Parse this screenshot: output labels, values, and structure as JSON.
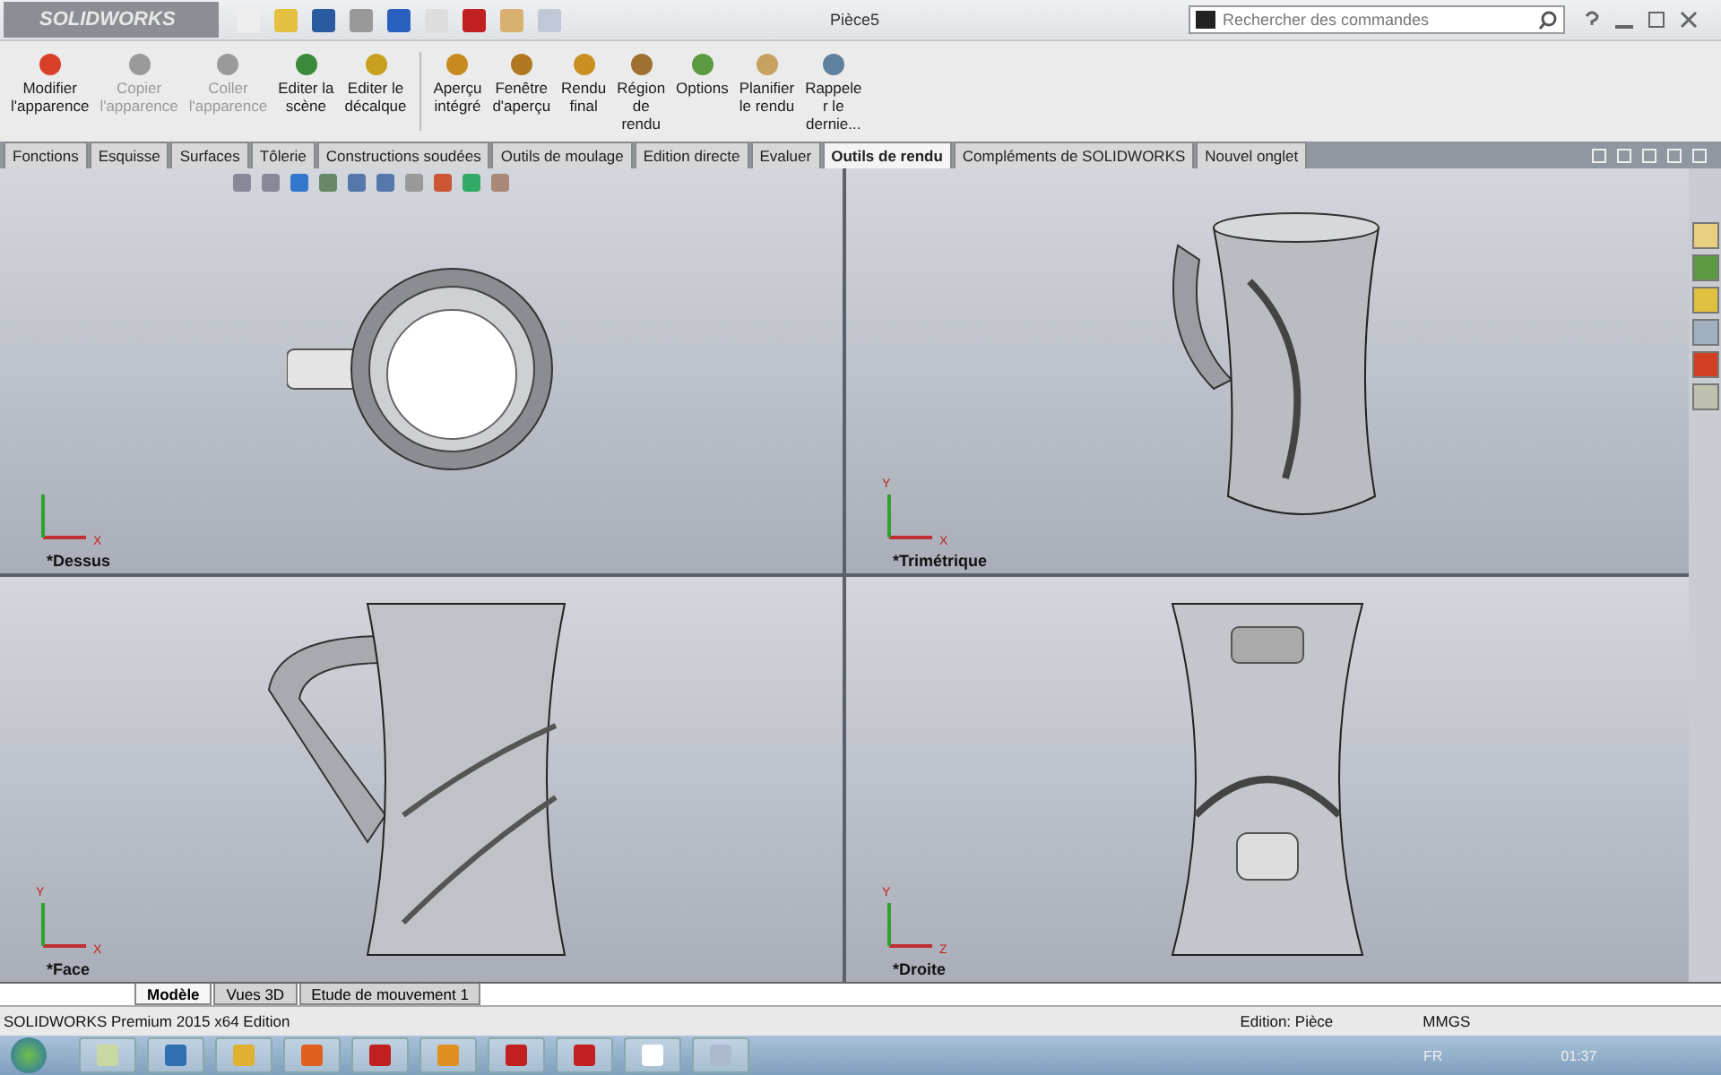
{
  "app": {
    "logo": "SOLIDWORKS",
    "title": "Pièce5"
  },
  "search": {
    "placeholder": "Rechercher des commandes"
  },
  "ribbon": [
    {
      "label": "Modifier\nl'apparence",
      "disabled": false,
      "color": "#d8402a"
    },
    {
      "label": "Copier\nl'apparence",
      "disabled": true,
      "color": "#9a9a9a"
    },
    {
      "label": "Coller\nl'apparence",
      "disabled": true,
      "color": "#9a9a9a"
    },
    {
      "label": "Editer la\nscène",
      "disabled": false,
      "color": "#3a8a3a"
    },
    {
      "label": "Editer le\ndécalque",
      "disabled": false,
      "color": "#c8a020"
    },
    {
      "label": "Aperçu\nintégré",
      "disabled": false,
      "color": "#c88a20"
    },
    {
      "label": "Fenêtre\nd'aperçu",
      "disabled": false,
      "color": "#b07820"
    },
    {
      "label": "Rendu\nfinal",
      "disabled": false,
      "color": "#c89020"
    },
    {
      "label": "Région\nde\nrendu",
      "disabled": false,
      "color": "#a07030"
    },
    {
      "label": "Options",
      "disabled": false,
      "color": "#5a9a40"
    },
    {
      "label": "Planifier\nle rendu",
      "disabled": false,
      "color": "#c8a060"
    },
    {
      "label": "Rappele\nr le\ndernie...",
      "disabled": false,
      "color": "#6080a0"
    }
  ],
  "tabs": [
    {
      "label": "Fonctions",
      "selected": false
    },
    {
      "label": "Esquisse",
      "selected": false
    },
    {
      "label": "Surfaces",
      "selected": false
    },
    {
      "label": "Tôlerie",
      "selected": false
    },
    {
      "label": "Constructions soudées",
      "selected": false
    },
    {
      "label": "Outils de moulage",
      "selected": false
    },
    {
      "label": "Edition directe",
      "selected": false
    },
    {
      "label": "Evaluer",
      "selected": false
    },
    {
      "label": "Outils de rendu",
      "selected": true
    },
    {
      "label": "Compléments de SOLIDWORKS",
      "selected": false
    },
    {
      "label": "Nouvel onglet",
      "selected": false
    }
  ],
  "views": [
    {
      "name": "*Dessus",
      "kind": "top",
      "axes": [
        "X"
      ]
    },
    {
      "name": "*Trimétrique",
      "kind": "trimetric",
      "axes": [
        "Y",
        "X"
      ]
    },
    {
      "name": "*Face",
      "kind": "front",
      "axes": [
        "Y",
        "X"
      ]
    },
    {
      "name": "*Droite",
      "kind": "right",
      "axes": [
        "Y",
        "Z"
      ]
    }
  ],
  "bottom_tabs": [
    {
      "label": "Modèle",
      "selected": true
    },
    {
      "label": "Vues 3D",
      "selected": false
    },
    {
      "label": "Etude de mouvement 1",
      "selected": false
    }
  ],
  "status_bar": {
    "product": "SOLIDWORKS Premium 2015 x64 Edition",
    "mode": "Edition: Pièce",
    "units": "MMGS"
  },
  "taskbar": {
    "language": "FR",
    "time": "01:37"
  }
}
